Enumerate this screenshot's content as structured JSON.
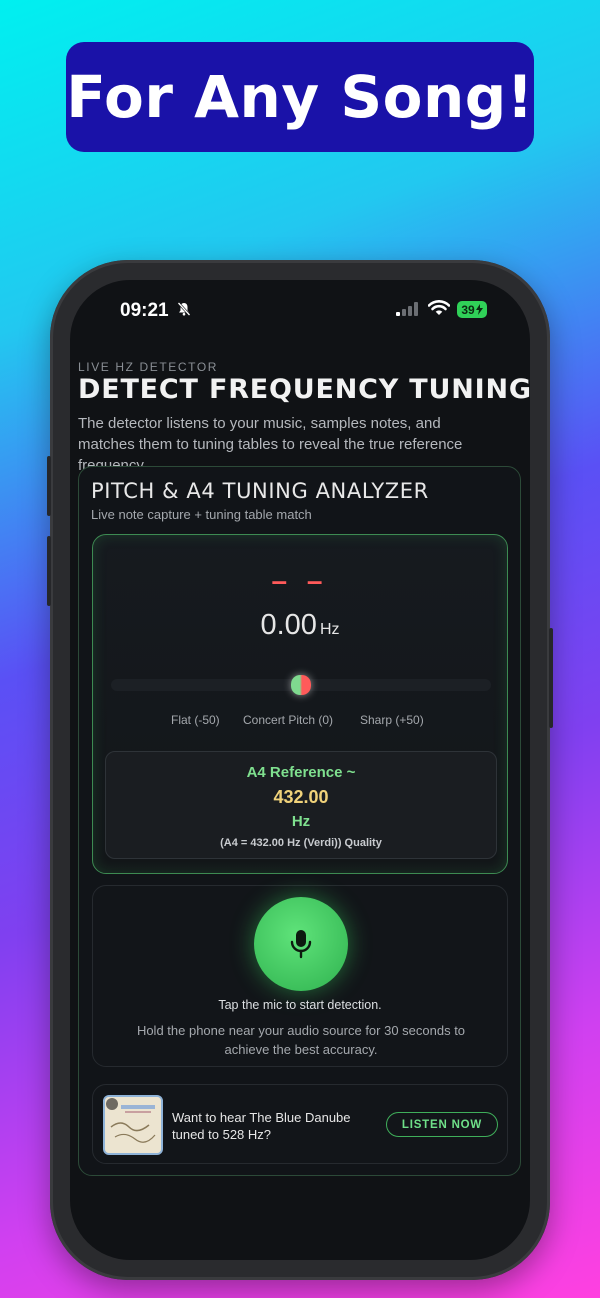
{
  "banner": {
    "text": "For Any Song!"
  },
  "status_bar": {
    "time": "09:21",
    "battery": "39"
  },
  "header": {
    "eyebrow": "LIVE HZ DETECTOR",
    "title": "DETECT FREQUENCY TUNING",
    "description": "The detector listens to your music, samples notes, and matches them to tuning tables to reveal the true reference frequency."
  },
  "analyzer": {
    "title": "PITCH & A4 TUNING ANALYZER",
    "subtitle": "Live note capture + tuning table match",
    "note": "– –",
    "frequency": "0.00",
    "frequency_unit": "Hz",
    "cents_offset": 0,
    "scale": {
      "flat": "Flat (-50)",
      "center": "Concert Pitch (0)",
      "sharp": "Sharp (+50)"
    },
    "reference": {
      "label": "A4 Reference ~",
      "value": "432.00",
      "unit": "Hz",
      "note": "(A4 = 432.00 Hz (Verdi)) Quality"
    }
  },
  "mic": {
    "hint": "Tap the mic to start detection.",
    "sub": "Hold the phone near your audio source for 30 seconds to achieve the best accuracy."
  },
  "promo": {
    "text": "Want to hear The Blue Danube tuned to 528 Hz?",
    "button": "LISTEN NOW"
  },
  "colors": {
    "accent_green": "#3fae5a",
    "note_red": "#ff5a5a",
    "reference_gold": "#f0d27a",
    "banner": "#1a12a8"
  }
}
